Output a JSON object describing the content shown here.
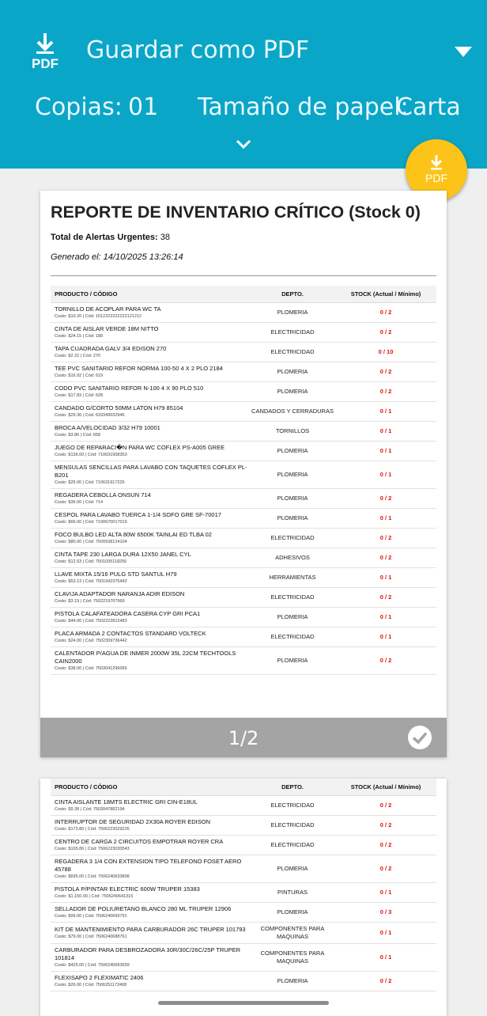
{
  "header": {
    "destination": "Guardar como PDF",
    "copies_label": "Copias:",
    "copies_value": "01",
    "paper_label": "Tamaño de papel:",
    "paper_value": "Carta",
    "pdf_icon_text": "PDF",
    "fab_label": "PDF",
    "accent_color": "#0aa6c8",
    "fab_color": "#fcc318"
  },
  "report": {
    "title": "REPORTE DE INVENTARIO CRÍTICO (Stock 0)",
    "alerts_label": "Total de Alertas Urgentes:",
    "alerts_value": "38",
    "generated": "Generado el: 14/10/2025 13:26:14",
    "col_product": "PRODUCTO / CÓDIGO",
    "col_dept": "DEPTO.",
    "col_stock": "STOCK (Actual / Mínimo)"
  },
  "page1": {
    "page_indicator": "1/2",
    "rows": [
      {
        "name": "TORNILLO DE ACOPLAR PARA WC TA",
        "meta": "Costo: $10.20 | Cód: 1012222222222121212",
        "dept": "PLOMERIA",
        "stock": "0 / 2"
      },
      {
        "name": "CINTA DE AISLAR VERDE 18M NITTO",
        "meta": "Costo: $24.15 | Cód: 188",
        "dept": "ELECTRICIDAD",
        "stock": "0 / 2"
      },
      {
        "name": "TAPA CUADRADA GALV 3/4 EDISON 270",
        "meta": "Costo: $2.22 | Cód: 270",
        "dept": "ELECTRICIDAD",
        "stock": "0 / 10"
      },
      {
        "name": "TEE PVC SANITARIO REFOR NORMA 100-50 4 X 2 PLO 2184",
        "meta": "Costo: $16.92 | Cód: 619",
        "dept": "PLOMERIA",
        "stock": "0 / 2"
      },
      {
        "name": "CODO PVC SANITARIO REFOR N-100 4 X 90 PLO 510",
        "meta": "Costo: $17.83 | Cód: 628",
        "dept": "PLOMERIA",
        "stock": "0 / 2"
      },
      {
        "name": "CANDADO G/CORTO 50MM LATON H79 85104",
        "meta": "Costo: $29.36 | Cód: 633349032946",
        "dept": "CANDADOS Y CERRADURAS",
        "stock": "0 / 1"
      },
      {
        "name": "BROCA A/VELOCIDAD 3/32 H79 10001",
        "meta": "Costo: $3.86 | Cód: 658",
        "dept": "TORNILLOS",
        "stock": "0 / 1"
      },
      {
        "name": "JUEGO DE REPARACI�N PARA WC COFLEX PS-A005 GREE",
        "meta": "Costo: $136.00 | Cód: 710631908353",
        "dept": "PLOMERIA",
        "stock": "0 / 1"
      },
      {
        "name": "MENSULAS SENCILLAS PARA LAVABO CON TAQUETES COFLEX PL-B201",
        "meta": "Costo: $25.00 | Cód: 710631917225",
        "dept": "PLOMERIA",
        "stock": "0 / 1"
      },
      {
        "name": "REGADERA CEBOLLA ONSUN 714",
        "meta": "Costo: $36.00 | Cód: 714",
        "dept": "PLOMERIA",
        "stock": "0 / 2"
      },
      {
        "name": "CESPOL PARA LAVABO TUERCA 1-1/4 SOFO GRE SF-70017",
        "meta": "Costo: $66.00 | Cód: 7190670017019",
        "dept": "PLOMERIA",
        "stock": "0 / 1"
      },
      {
        "name": "FOCO BULBO LED ALTA 80W 6500K TAINLAI ED TLBA 02",
        "meta": "Costo: $80.00 | Cód: 7500938124104",
        "dept": "ELECTRICIDAD",
        "stock": "0 / 2"
      },
      {
        "name": "CINTA TAPE 230 LARGA DURA 12X50 JANEL CYL",
        "meta": "Costo: $12.53 | Cód: 7501035118256",
        "dept": "ADHESIVOS",
        "stock": "0 / 2"
      },
      {
        "name": "LLAVE MIXTA 15/16 PULG STD SANTUL H79",
        "meta": "Costo: $53.13 | Cód: 7501942376442",
        "dept": "HERRAMIENTAS",
        "stock": "0 / 1"
      },
      {
        "name": "CLAVIJA ADAPTADOR NARANJA ADIR EDISON",
        "meta": "Costo: $3.19 | Cód: 7502219707969",
        "dept": "ELECTRICIDAD",
        "stock": "0 / 2"
      },
      {
        "name": "PISTOLA CALAFATEADORA CASERA CYP GRI PCA1",
        "meta": "Costo: $44.00 | Cód: 7502222812483",
        "dept": "PLOMERIA",
        "stock": "0 / 1"
      },
      {
        "name": "PLACA ARMADA 2 CONTACTOS STANDARD VOLTECK",
        "meta": "Costo: $24.00 | Cód: 7502309736442",
        "dept": "ELECTRICIDAD",
        "stock": "0 / 1"
      },
      {
        "name": "CALENTADOR P/AGUA DE INMER 2000W 35L 22CM TECHTOOLS CAIN2000",
        "meta": "Costo: $38.00 | Cód: 7503041296065",
        "dept": "PLOMERIA",
        "stock": "0 / 2"
      }
    ]
  },
  "page2": {
    "rows": [
      {
        "name": "CINTA AISLANTE 18MTS ELECTRIC GRI CIN-E18UL",
        "meta": "Costo: $9.38 | Cód: 7503047882194",
        "dept": "ELECTRICIDAD",
        "stock": "0 / 2"
      },
      {
        "name": "INTERRUPTOR DE SEGURIDAD 2X30A ROYER EDISON",
        "meta": "Costo: $173.80 | Cód: 7506223029226",
        "dept": "ELECTRICIDAD",
        "stock": "0 / 2"
      },
      {
        "name": "CENTRO DE CARGA 2 CIRCUITOS EMPOTRAR ROYER CRA",
        "meta": "Costo: $165.86 | Cód: 7506223030543",
        "dept": "ELECTRICIDAD",
        "stock": "0 / 2"
      },
      {
        "name": "REGADERA 3 1/4 CON EXTENSION TIPO TELEFONO FOSET AERO 45788",
        "meta": "Costo: $695.00 | Cód: 7506240633808",
        "dept": "PLOMERIA",
        "stock": "0 / 2"
      },
      {
        "name": "PISTOLA P/PINTAR ELECTRIC 600W TRUPER 15383",
        "meta": "Costo: $1,150.00 | Cód: 7506240641315",
        "dept": "PINTURAS",
        "stock": "0 / 1"
      },
      {
        "name": "SELLADOR DE POLIURETANO BLANCO 280 ML TRUPER 12906",
        "meta": "Costo: $99.00 | Cód: 7506240669791",
        "dept": "PLOMERIA",
        "stock": "0 / 3"
      },
      {
        "name": "KIT DE MANTENIMIENTO PARA CARBURADOR 26C TRUPER 101793",
        "meta": "Costo: $79.00 | Cód: 7506240688761",
        "dept": "COMPONENTES PARA MAQUINAS",
        "stock": "0 / 1"
      },
      {
        "name": "CARBURADOR PARA DESBROZADORA 30R/30C/26C/25P TRUPER 101814",
        "meta": "Costo: $425.00 | Cód: 7506240693659",
        "dept": "COMPONENTES PARA MAQUINAS",
        "stock": "0 / 1"
      },
      {
        "name": "FLEXISAPO 2 FLEXIMATIC 2406",
        "meta": "Costo: $26.00 | Cód: 7506251172408",
        "dept": "PLOMERIA",
        "stock": "0 / 2"
      }
    ]
  }
}
